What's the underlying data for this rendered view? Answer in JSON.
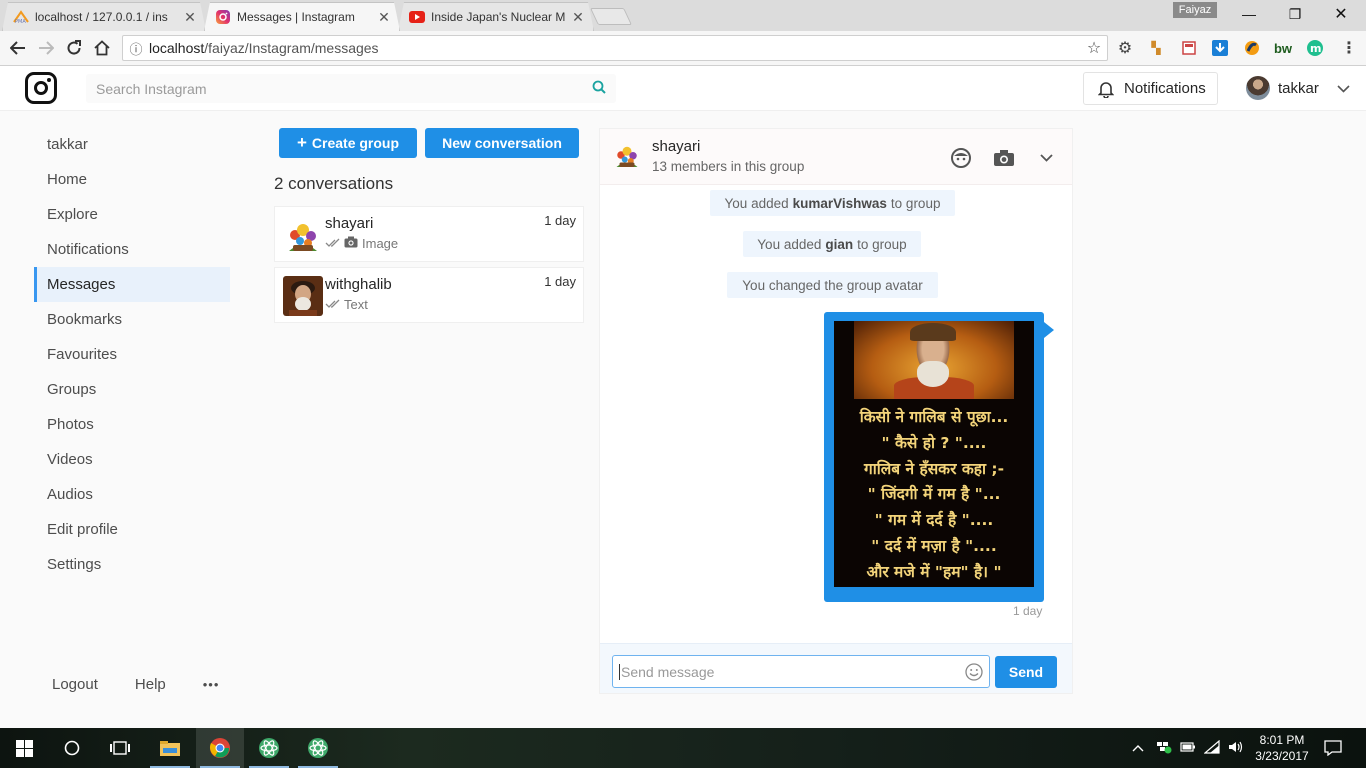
{
  "browser": {
    "tabs": [
      {
        "title": "localhost / 127.0.0.1 / ins",
        "favicon": "phpmyadmin-icon",
        "active": false
      },
      {
        "title": "Messages | Instagram",
        "favicon": "instagram-icon",
        "active": true
      },
      {
        "title": "Inside Japan's Nuclear M",
        "favicon": "youtube-icon",
        "active": false
      }
    ],
    "profile_name": "Faiyaz",
    "url_host": "localhost",
    "url_path": "/faiyaz/Instagram/messages"
  },
  "header": {
    "search_placeholder": "Search Instagram",
    "notifications_label": "Notifications",
    "username": "takkar"
  },
  "sidebar": {
    "items": [
      {
        "label": "takkar"
      },
      {
        "label": "Home"
      },
      {
        "label": "Explore"
      },
      {
        "label": "Notifications"
      },
      {
        "label": "Messages"
      },
      {
        "label": "Bookmarks"
      },
      {
        "label": "Favourites"
      },
      {
        "label": "Groups"
      },
      {
        "label": "Photos"
      },
      {
        "label": "Videos"
      },
      {
        "label": "Audios"
      },
      {
        "label": "Edit profile"
      },
      {
        "label": "Settings"
      }
    ],
    "active_item": "Messages",
    "footer": {
      "logout": "Logout",
      "help": "Help",
      "more": "•••"
    }
  },
  "conversations": {
    "create_group_label": "Create group",
    "new_conversation_label": "New conversation",
    "count_label": "2 conversations",
    "items": [
      {
        "name": "shayari",
        "last_type": "Image",
        "time": "1 day"
      },
      {
        "name": "withghalib",
        "last_type": "Text",
        "time": "1 day"
      }
    ]
  },
  "chat": {
    "group_name": "shayari",
    "members_label": "13 members in this group",
    "system_messages": [
      {
        "pre": "You added",
        "bold": "kumarVishwas",
        "post": "to group"
      },
      {
        "pre": "You added",
        "bold": "gian",
        "post": "to group"
      },
      {
        "text": "You changed the group avatar"
      }
    ],
    "image_text_lines": [
      "किसी ने गालिब से पूछा...",
      "\" कैसे हो ? \"....",
      "गालिब ने हँसकर कहा ;-",
      "\" जिंदगी में गम है \"...",
      "\" गम में दर्द है \"....",
      "\" दर्द में मज़ा है \"....",
      "और मजे में \"हम\" है। \""
    ],
    "message_time": "1 day",
    "composer_placeholder": "Send message",
    "send_label": "Send"
  },
  "taskbar": {
    "time": "8:01 PM",
    "date": "3/23/2017"
  },
  "colors": {
    "accent": "#1f8fe6",
    "active_nav_bg": "#e8f1fb",
    "system_msg_bg": "#eef5fd"
  }
}
